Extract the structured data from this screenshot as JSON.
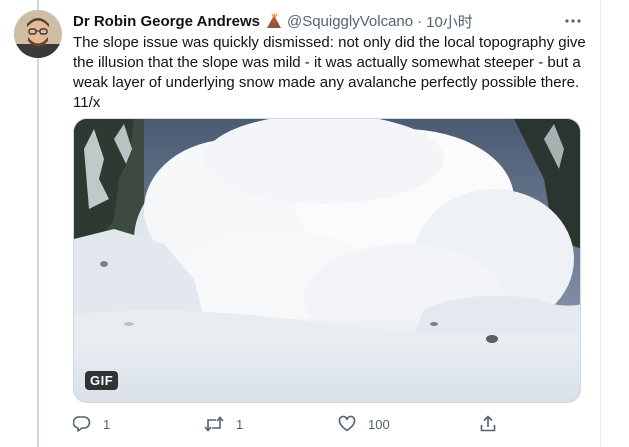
{
  "tweet": {
    "author_name": "Dr Robin George Andrews",
    "author_emoji_icon": "volcano-icon",
    "handle": "@SquigglyVolcano",
    "separator": "·",
    "time": "10小时",
    "text": "The slope issue was quickly dismissed: not only did the local topography give the illusion that the slope was mild - it was actually somewhat steeper - but a weak layer of underlying snow made any avalanche perfectly possible there. 11/x",
    "media": {
      "type": "gif",
      "badge": "GIF",
      "subject": "avalanche-image"
    },
    "actions": {
      "reply_count": "1",
      "retweet_count": "1",
      "like_count": "100"
    }
  },
  "colors": {
    "text_primary": "#0f1419",
    "text_secondary": "#536471",
    "thread_line": "#cfd9de",
    "badge_bg": "#000000"
  }
}
